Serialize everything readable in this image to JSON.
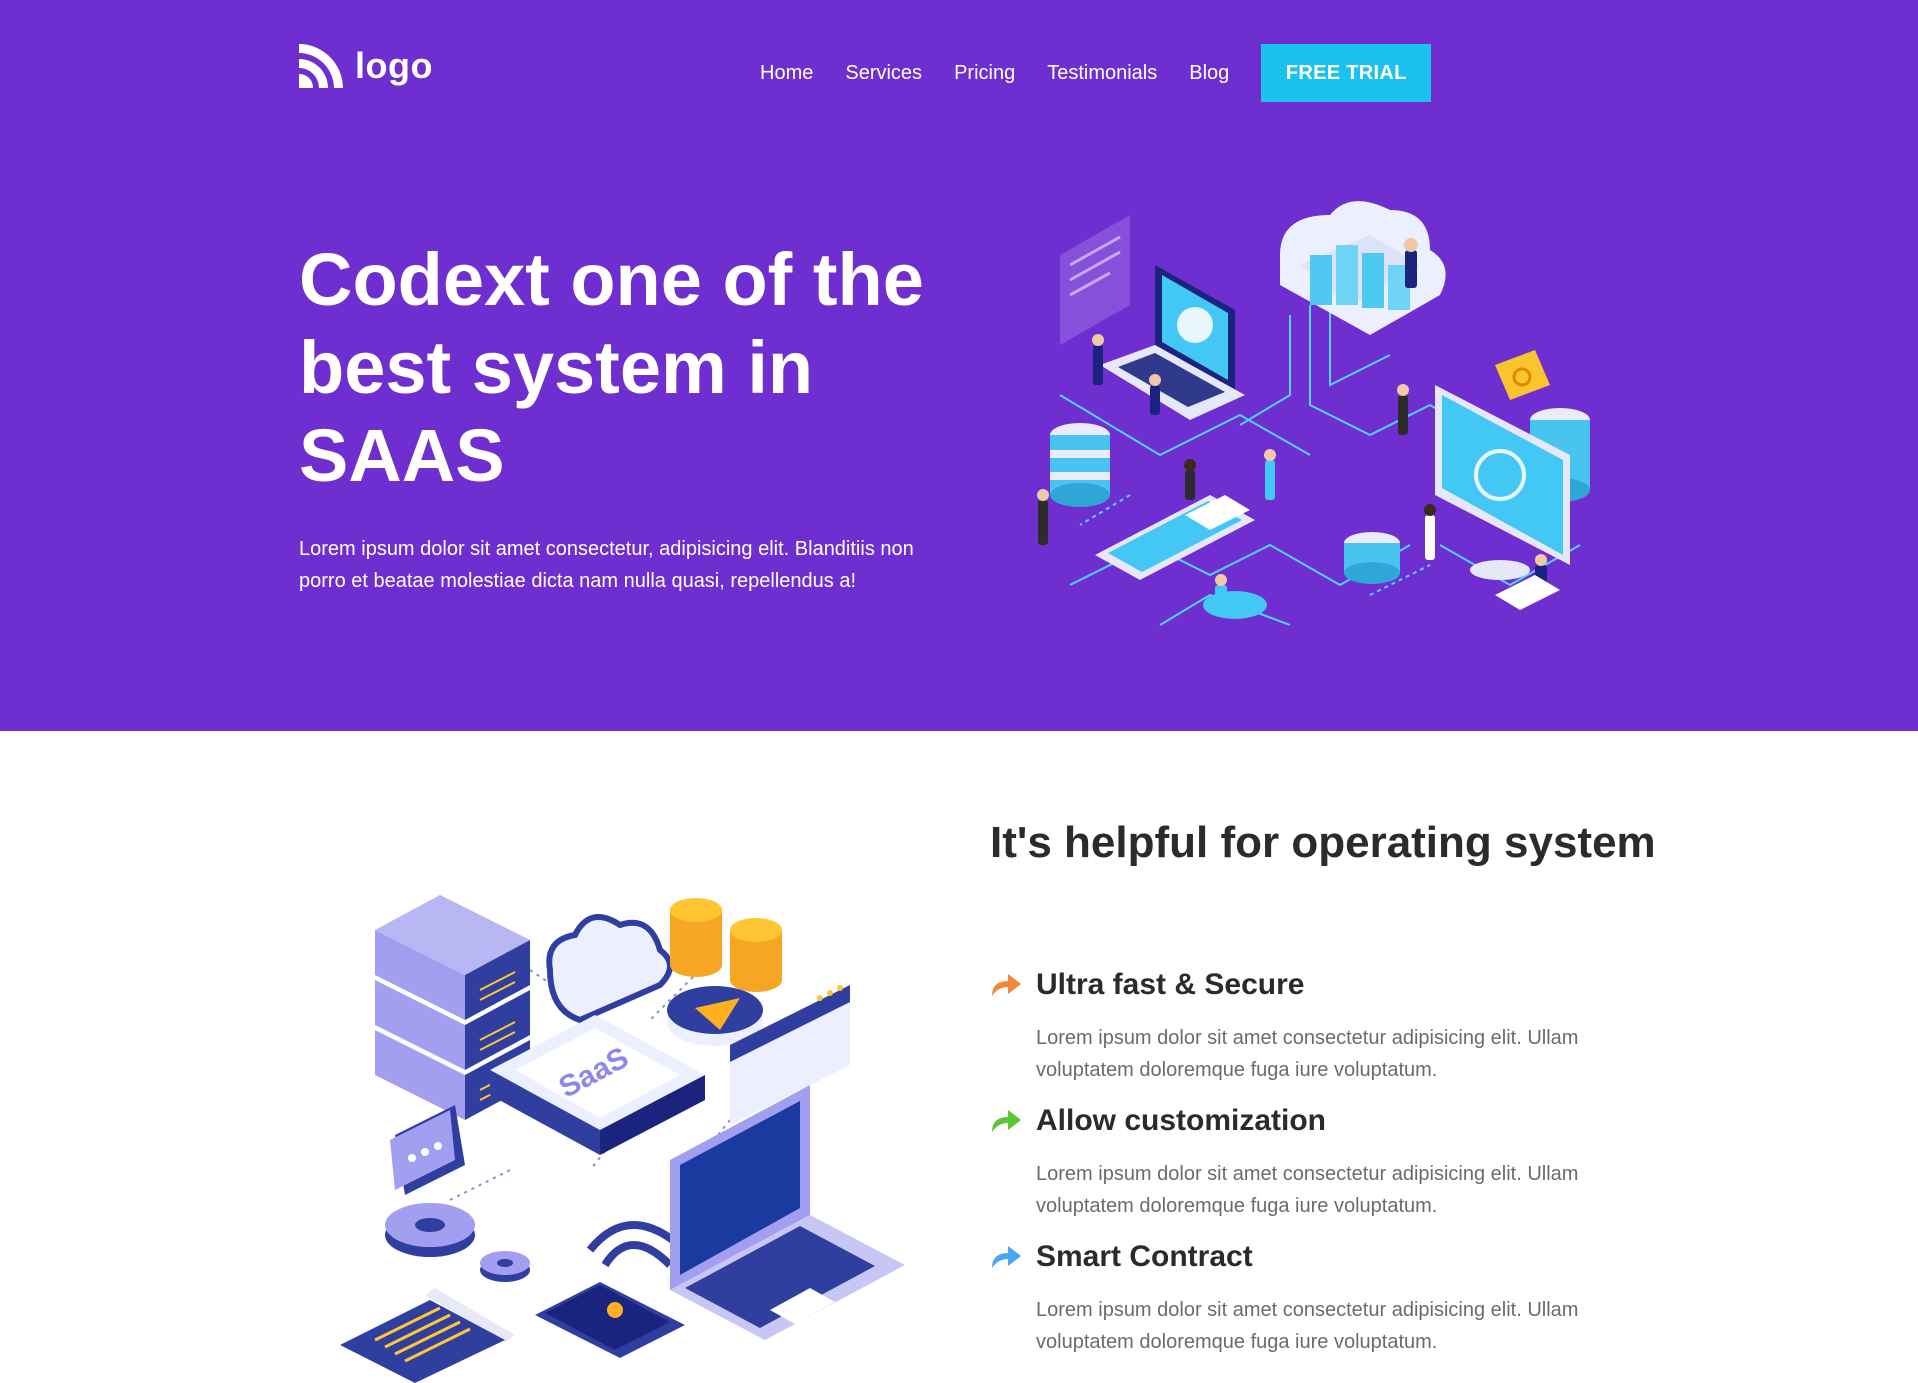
{
  "brand": {
    "logo_text": "logo"
  },
  "nav": {
    "links": [
      "Home",
      "Services",
      "Pricing",
      "Testimonials",
      "Blog"
    ],
    "cta_label": "FREE TRIAL"
  },
  "hero": {
    "title": "Codext one of the best system in SAAS",
    "text": "Lorem ipsum dolor sit amet consectetur, adipisicing elit. Blanditiis non porro et beatae molestiae dicta nam nulla quasi, repellendus a!"
  },
  "features": {
    "heading": "It's helpful for operating system",
    "illustration_label": "SaaS",
    "items": [
      {
        "title": "Ultra fast & Secure",
        "text": "Lorem ipsum dolor sit amet consectetur adipisicing elit. Ullam voluptatem doloremque fuga iure voluptatum.",
        "icon": "arrow-forward-icon",
        "color": "#f0883a"
      },
      {
        "title": "Allow customization",
        "text": "Lorem ipsum dolor sit amet consectetur adipisicing elit. Ullam voluptatem doloremque fuga iure voluptatum.",
        "icon": "arrow-forward-icon",
        "color": "#5cc33b"
      },
      {
        "title": "Smart Contract",
        "text": "Lorem ipsum dolor sit amet consectetur adipisicing elit. Ullam voluptatem doloremque fuga iure voluptatum.",
        "icon": "arrow-forward-icon",
        "color": "#4aa5f0"
      }
    ]
  },
  "colors": {
    "hero_bg": "#6f2ecf",
    "cta_bg": "#1cc2ee",
    "heading": "#2b2b2b",
    "body_text": "#6b6b6b"
  }
}
